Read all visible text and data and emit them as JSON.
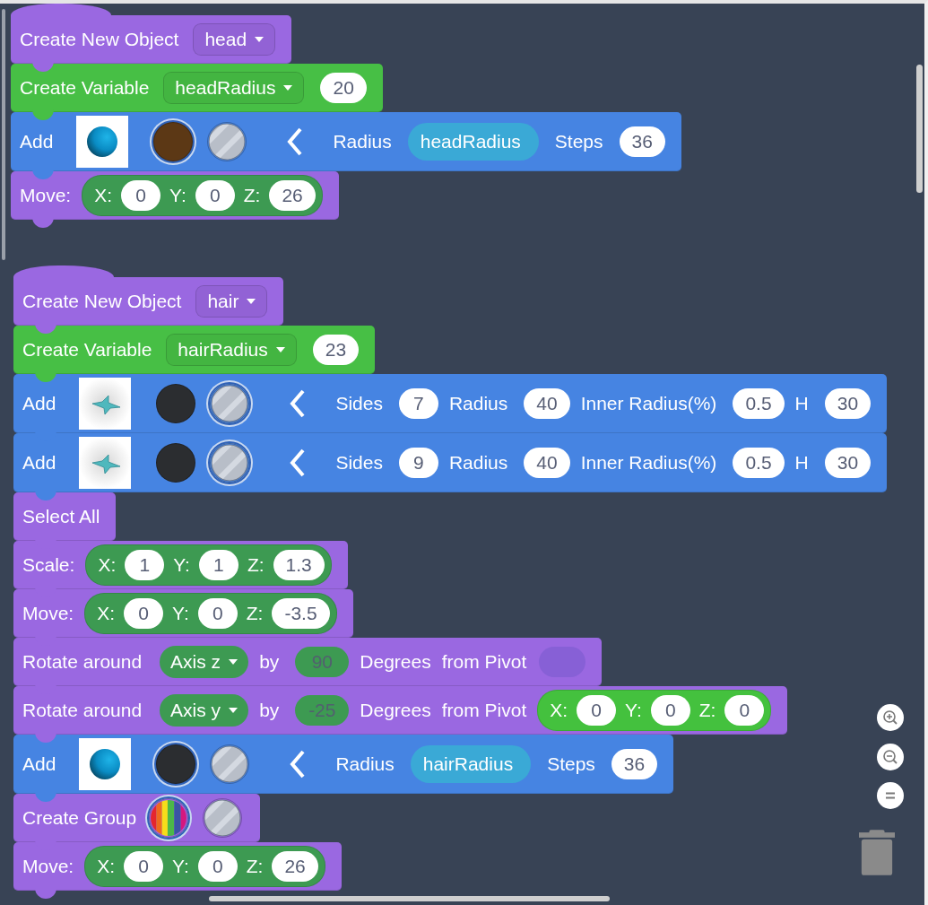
{
  "stacks": [
    {
      "blocks": [
        {
          "color": "#9a68e1",
          "parts": [
            {
              "kind": "label",
              "text": "Create New Object"
            },
            {
              "kind": "dropdown",
              "text": "head"
            }
          ]
        },
        {
          "color": "#47bf45",
          "parts": [
            {
              "kind": "label",
              "text": "Create Variable"
            },
            {
              "kind": "dropdown",
              "text": "headRadius"
            },
            {
              "kind": "number",
              "text": "20"
            }
          ]
        },
        {
          "color": "#4684e2",
          "parts": [
            {
              "kind": "label",
              "text": "Add"
            },
            {
              "kind": "sphere-thumb"
            },
            {
              "kind": "color-swatch",
              "color": "#5c3815",
              "selected": true
            },
            {
              "kind": "clear-swatch",
              "selected": false
            },
            {
              "kind": "arrow"
            },
            {
              "kind": "label",
              "text": "Radius"
            },
            {
              "kind": "variable",
              "text": "headRadius"
            },
            {
              "kind": "label",
              "text": "Steps"
            },
            {
              "kind": "number",
              "text": "36"
            }
          ]
        },
        {
          "color": "#9a68e1",
          "parts": [
            {
              "kind": "label",
              "text": "Move:"
            },
            {
              "kind": "vector",
              "color": "#3d9a52",
              "axes": [
                {
                  "label": "X:",
                  "value": "0"
                },
                {
                  "label": "Y:",
                  "value": "0"
                },
                {
                  "label": "Z:",
                  "value": "26"
                }
              ]
            }
          ]
        }
      ]
    },
    {
      "blocks": [
        {
          "color": "#9a68e1",
          "parts": [
            {
              "kind": "label",
              "text": "Create New Object"
            },
            {
              "kind": "dropdown",
              "text": "hair"
            }
          ]
        },
        {
          "color": "#47bf45",
          "parts": [
            {
              "kind": "label",
              "text": "Create Variable"
            },
            {
              "kind": "dropdown",
              "text": "hairRadius"
            },
            {
              "kind": "number",
              "text": "23"
            }
          ]
        },
        {
          "color": "#4684e2",
          "parts": [
            {
              "kind": "label",
              "text": "Add"
            },
            {
              "kind": "star-thumb"
            },
            {
              "kind": "color-swatch",
              "color": "#2b2d30",
              "selected": false
            },
            {
              "kind": "clear-swatch",
              "selected": true
            },
            {
              "kind": "arrow"
            },
            {
              "kind": "label",
              "text": "Sides"
            },
            {
              "kind": "number",
              "text": "7"
            },
            {
              "kind": "label",
              "text": "Radius"
            },
            {
              "kind": "number",
              "text": "40"
            },
            {
              "kind": "label",
              "text": "Inner Radius(%)"
            },
            {
              "kind": "number",
              "text": "0.5"
            },
            {
              "kind": "label",
              "text": "H"
            },
            {
              "kind": "number",
              "text": "30"
            }
          ]
        },
        {
          "color": "#4684e2",
          "parts": [
            {
              "kind": "label",
              "text": "Add"
            },
            {
              "kind": "star-thumb"
            },
            {
              "kind": "color-swatch",
              "color": "#2b2d30",
              "selected": false
            },
            {
              "kind": "clear-swatch",
              "selected": true
            },
            {
              "kind": "arrow"
            },
            {
              "kind": "label",
              "text": "Sides"
            },
            {
              "kind": "number",
              "text": "9"
            },
            {
              "kind": "label",
              "text": "Radius"
            },
            {
              "kind": "number",
              "text": "40"
            },
            {
              "kind": "label",
              "text": "Inner Radius(%)"
            },
            {
              "kind": "number",
              "text": "0.5"
            },
            {
              "kind": "label",
              "text": "H"
            },
            {
              "kind": "number",
              "text": "30"
            }
          ]
        },
        {
          "color": "#9a68e1",
          "parts": [
            {
              "kind": "label",
              "text": "Select All"
            }
          ]
        },
        {
          "color": "#9a68e1",
          "parts": [
            {
              "kind": "label",
              "text": "Scale:"
            },
            {
              "kind": "vector",
              "color": "#3d9a52",
              "axes": [
                {
                  "label": "X:",
                  "value": "1"
                },
                {
                  "label": "Y:",
                  "value": "1"
                },
                {
                  "label": "Z:",
                  "value": "1.3"
                }
              ]
            }
          ]
        },
        {
          "color": "#9a68e1",
          "parts": [
            {
              "kind": "label",
              "text": "Move:"
            },
            {
              "kind": "vector",
              "color": "#3d9a52",
              "axes": [
                {
                  "label": "X:",
                  "value": "0"
                },
                {
                  "label": "Y:",
                  "value": "0"
                },
                {
                  "label": "Z:",
                  "value": "-3.5"
                }
              ]
            }
          ]
        },
        {
          "color": "#9a68e1",
          "parts": [
            {
              "kind": "label",
              "text": "Rotate around"
            },
            {
              "kind": "axis-dropdown",
              "text": "Axis z"
            },
            {
              "kind": "label",
              "text": "by"
            },
            {
              "kind": "shadow-number",
              "text": "90"
            },
            {
              "kind": "label",
              "text": "Degrees"
            },
            {
              "kind": "label",
              "text": "from Pivot"
            },
            {
              "kind": "slot"
            }
          ]
        },
        {
          "color": "#9a68e1",
          "parts": [
            {
              "kind": "label",
              "text": "Rotate around"
            },
            {
              "kind": "axis-dropdown",
              "text": "Axis y"
            },
            {
              "kind": "label",
              "text": "by"
            },
            {
              "kind": "shadow-number",
              "text": "-25"
            },
            {
              "kind": "label",
              "text": "Degrees"
            },
            {
              "kind": "label",
              "text": "from Pivot"
            },
            {
              "kind": "vector",
              "color": "#44c13e",
              "axes": [
                {
                  "label": "X:",
                  "value": "0"
                },
                {
                  "label": "Y:",
                  "value": "0"
                },
                {
                  "label": "Z:",
                  "value": "0"
                }
              ]
            }
          ]
        },
        {
          "color": "#4684e2",
          "parts": [
            {
              "kind": "label",
              "text": "Add"
            },
            {
              "kind": "sphere-thumb"
            },
            {
              "kind": "color-swatch",
              "color": "#2b2d30",
              "selected": true
            },
            {
              "kind": "clear-swatch",
              "selected": false
            },
            {
              "kind": "arrow"
            },
            {
              "kind": "label",
              "text": "Radius"
            },
            {
              "kind": "variable",
              "text": "hairRadius"
            },
            {
              "kind": "label",
              "text": "Steps"
            },
            {
              "kind": "number",
              "text": "36"
            }
          ]
        },
        {
          "color": "#9a68e1",
          "parts": [
            {
              "kind": "label",
              "text": "Create Group"
            },
            {
              "kind": "rainbow-swatch",
              "selected": true
            },
            {
              "kind": "clear-swatch",
              "selected": false
            }
          ]
        },
        {
          "color": "#9a68e1",
          "parts": [
            {
              "kind": "label",
              "text": "Move:"
            },
            {
              "kind": "vector",
              "color": "#3d9a52",
              "axes": [
                {
                  "label": "X:",
                  "value": "0"
                },
                {
                  "label": "Y:",
                  "value": "0"
                },
                {
                  "label": "Z:",
                  "value": "26"
                }
              ]
            }
          ]
        }
      ]
    }
  ]
}
